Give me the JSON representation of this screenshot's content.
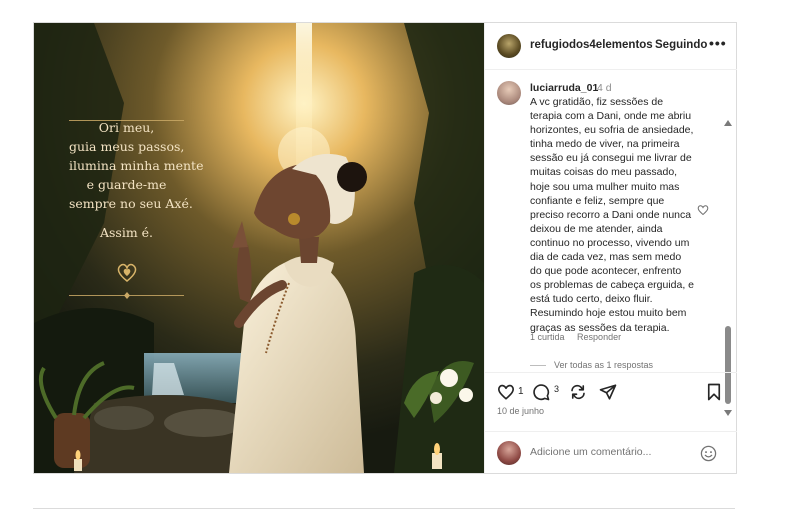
{
  "post": {
    "username": "refugiodos4elementos",
    "follow_status": "Seguindo",
    "more_icon": "•••"
  },
  "image": {
    "poem_lines": [
      "Ori meu,",
      "guia meus passos,",
      "ilumina minha mente",
      "e guarde-me",
      "sempre no seu Axé."
    ],
    "closing": "Assim é."
  },
  "comment": {
    "username": "luciarruda_01",
    "time": "4 d",
    "text_lines": [
      "A vc gratidão, fiz sessões de",
      "terapia com a Dani, onde me abriu",
      "horizontes, eu sofria de ansiedade,",
      "tinha medo de viver, na primeira",
      "sessão eu já consegui me livrar de",
      "muitas coisas do meu passado,",
      "hoje sou uma mulher muito mas",
      "confiante e feliz, sempre que",
      "preciso recorro a Dani onde nunca",
      "deixou de me atender, ainda",
      "continuo no processo, vivendo um",
      "dia de cada vez, mas sem medo",
      "do que pode acontecer, enfrento",
      "os problemas de cabeça erguida, e",
      "está tudo certo, deixo fluir.",
      "Resumindo hoje estou muito bem",
      "graças as sessões da terapia."
    ],
    "likes": "1 curtida",
    "reply": "Responder",
    "view_replies": "Ver todas as 1 respostas"
  },
  "actions": {
    "like_count": "1",
    "comment_count": "3",
    "date": "10 de junho"
  },
  "composer": {
    "placeholder": "Adicione um comentário..."
  },
  "colors": {
    "text": "#262626",
    "secondary": "#737373",
    "border": "#dbdbdb",
    "gold": "#c9a865"
  }
}
